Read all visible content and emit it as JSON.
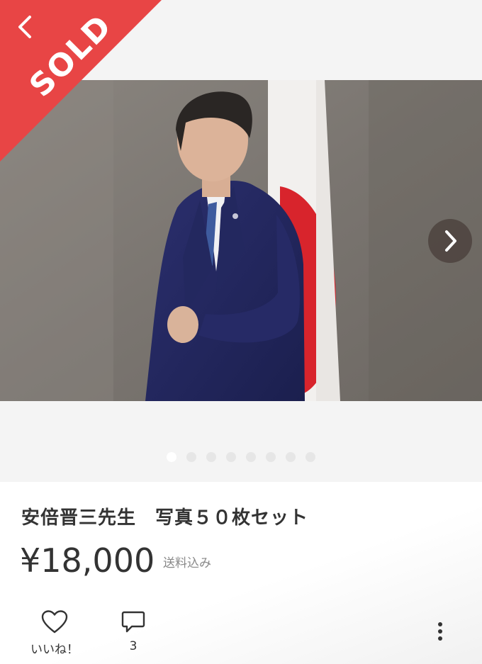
{
  "status_ribbon": {
    "label": "SOLD",
    "color": "#e84545"
  },
  "navigation": {
    "back_icon": "chevron-left-icon",
    "next_icon": "chevron-right-icon"
  },
  "gallery": {
    "image_count": 8,
    "current_index": 1
  },
  "item": {
    "title": "安倍晋三先生　写真５０枚セット",
    "price": "¥18,000",
    "shipping_note": "送料込み"
  },
  "actions": {
    "like": {
      "icon": "heart-icon",
      "label": "いいね！"
    },
    "comment": {
      "icon": "comment-icon",
      "count": "3"
    },
    "more": {
      "icon": "more-vertical-icon"
    }
  }
}
